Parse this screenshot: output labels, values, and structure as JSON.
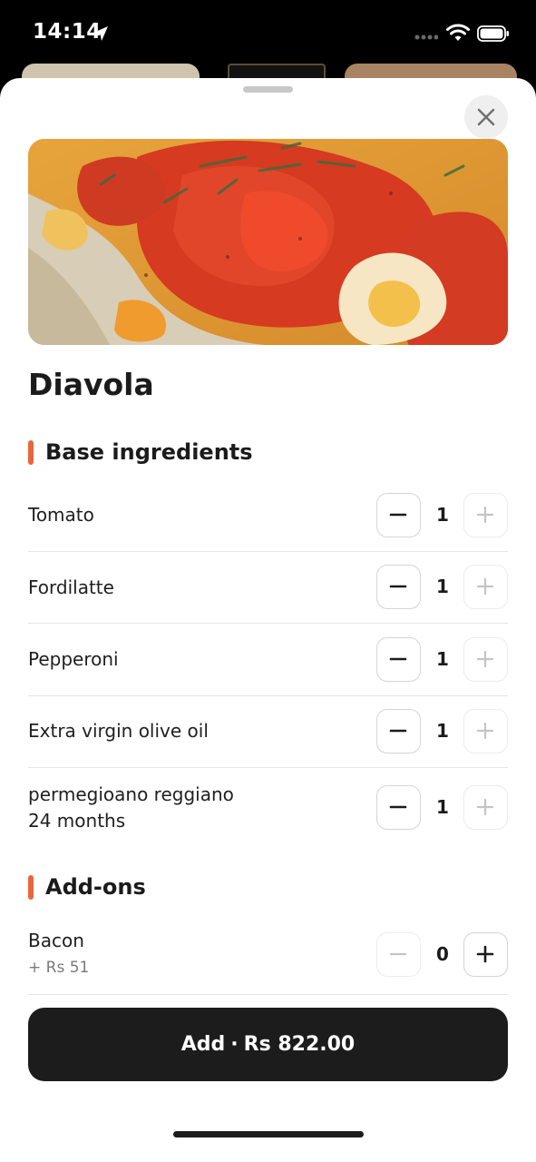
{
  "status_bar": {
    "time": "14:14",
    "icons": [
      "location-arrow-icon",
      "cellular-signal-icon",
      "wifi-icon",
      "battery-icon"
    ]
  },
  "colors": {
    "accent": "#e8663f",
    "primary_button": "#1c1c1c",
    "divider": "#e6e6e6"
  },
  "dish": {
    "name": "Diavola",
    "image": "pizza-photo"
  },
  "sections": {
    "base": {
      "title": "Base ingredients",
      "items": [
        {
          "name": "Tomato",
          "quantity": "1"
        },
        {
          "name": "Fordilatte",
          "quantity": "1"
        },
        {
          "name": "Pepperoni",
          "quantity": "1"
        },
        {
          "name": "Extra virgin olive oil",
          "quantity": "1"
        },
        {
          "name_line1": "permegioano reggiano",
          "name_line2": "24 months",
          "quantity": "1"
        }
      ]
    },
    "addons": {
      "title": "Add-ons",
      "items": [
        {
          "name": "Bacon",
          "price": "+ Rs 51",
          "quantity": "0"
        }
      ]
    }
  },
  "cta": {
    "label": "Add",
    "separator": "·",
    "price": "Rs 822.00"
  }
}
